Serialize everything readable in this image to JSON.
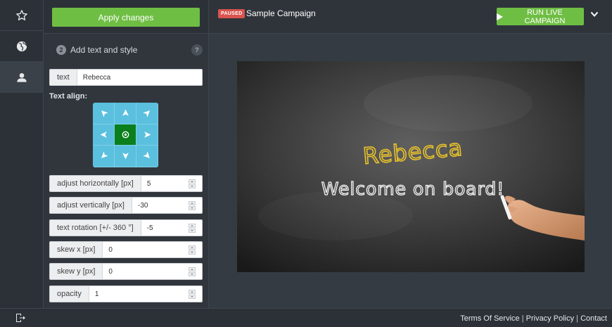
{
  "panel": {
    "apply_label": "Apply changes",
    "step_number": "2",
    "step_title": "Add text and style",
    "help": "?",
    "text_field": {
      "label": "text",
      "value": "Rebecca"
    },
    "align_label": "Text align:",
    "fields": [
      {
        "label": "adjust horizontally [px]",
        "value": "5"
      },
      {
        "label": "adjust vertically [px]",
        "value": "-30"
      },
      {
        "label": "text rotation [+/- 360 °]",
        "value": "-5"
      },
      {
        "label": "skew x [px]",
        "value": "0"
      },
      {
        "label": "skew y [px]",
        "value": "0"
      },
      {
        "label": "opacity",
        "value": "1"
      }
    ],
    "align_selected": "center"
  },
  "header": {
    "status_badge": "PAUSED",
    "campaign_name": "Sample Campaign",
    "run_label": "RUN LIVE CAMPAIGN"
  },
  "preview": {
    "name_text": "Rebecca",
    "message_text": "Welcome on board!"
  },
  "footer": {
    "terms": "Terms Of Service",
    "privacy": "Privacy Policy",
    "contact": "Contact",
    "separator": "|"
  },
  "colors": {
    "accent_green": "#6fbe44",
    "paused_red": "#d9534f",
    "align_blue": "#5bc0de",
    "align_selected": "#0a7f1c",
    "name_yellow": "#e8c22a"
  },
  "icons": {
    "rail": [
      "star-icon",
      "globe-icon",
      "user-icon"
    ],
    "footer": "logout-icon",
    "header": "chevron-down-icon"
  }
}
